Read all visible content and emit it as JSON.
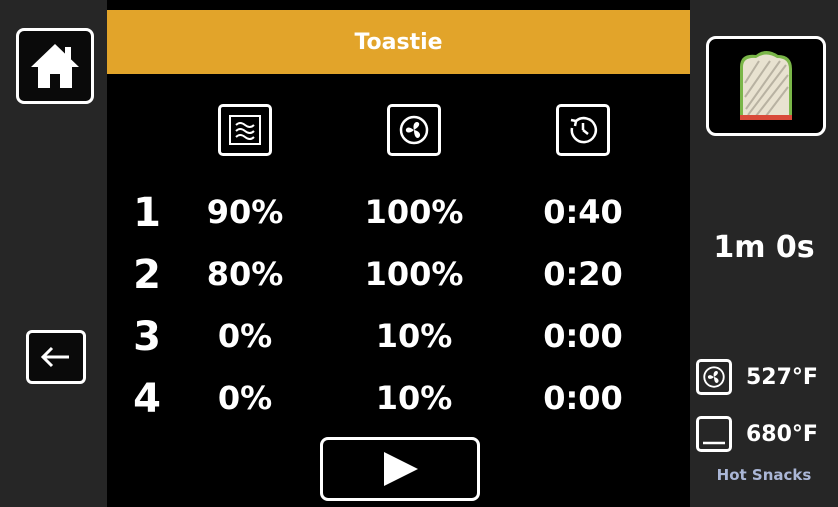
{
  "title": "Toastie",
  "nav": {
    "home_icon": "home-icon",
    "back_icon": "arrow-left-icon"
  },
  "columns": [
    {
      "icon": "microwave-power-icon",
      "label": "Microwave power"
    },
    {
      "icon": "fan-icon",
      "label": "Fan speed"
    },
    {
      "icon": "timer-icon",
      "label": "Time"
    }
  ],
  "stages": [
    {
      "num": "1",
      "power": "90%",
      "fan": "100%",
      "time": "0:40"
    },
    {
      "num": "2",
      "power": "80%",
      "fan": "100%",
      "time": "0:20"
    },
    {
      "num": "3",
      "power": "0%",
      "fan": "10%",
      "time": "0:00"
    },
    {
      "num": "4",
      "power": "0%",
      "fan": "10%",
      "time": "0:00"
    }
  ],
  "play_icon": "play-icon",
  "side": {
    "recipe_icon": "sandwich-icon",
    "total_time": "1m 0s",
    "fan_temp": "527°F",
    "element_temp": "680°F",
    "category": "Hot Snacks"
  },
  "colors": {
    "title_bar": "#e2a42a",
    "side_panel": "#262626",
    "background": "#000000",
    "category_text": "#aab6d6"
  }
}
